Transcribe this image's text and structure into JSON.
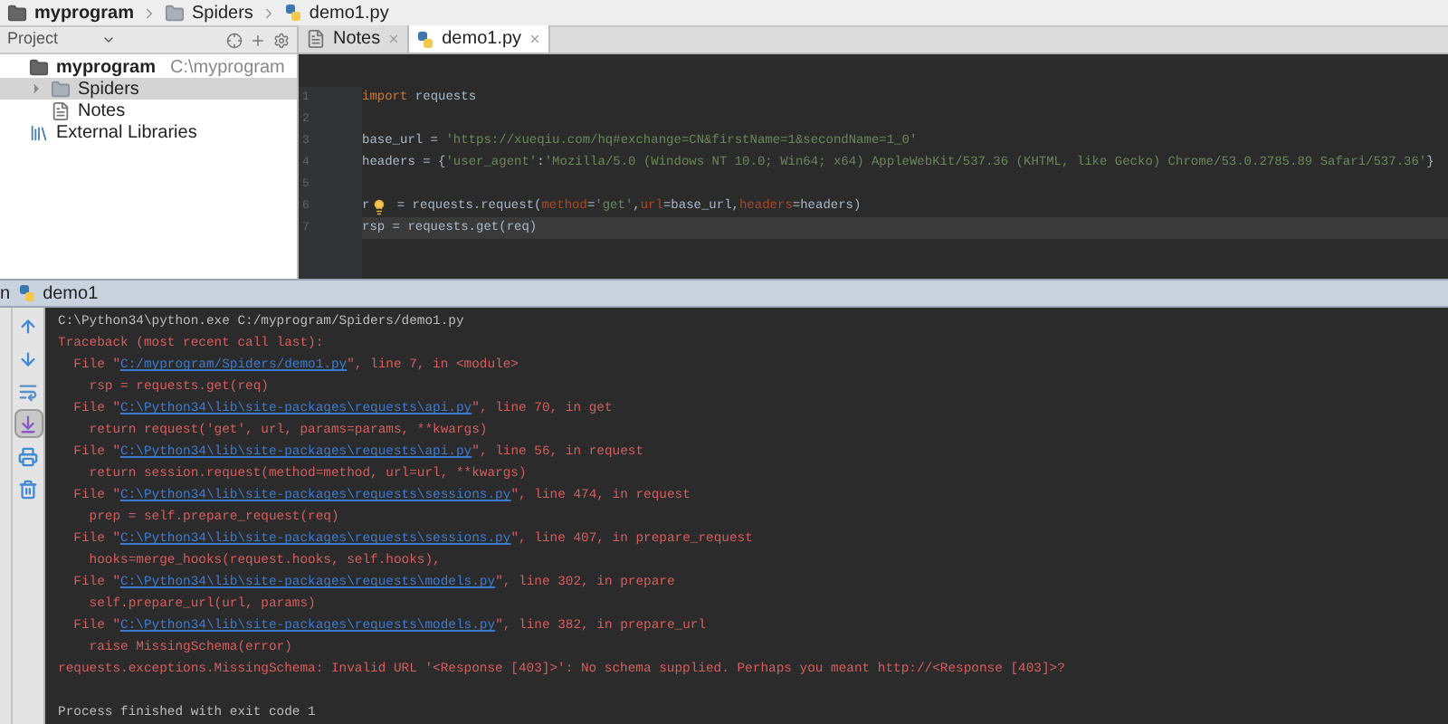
{
  "breadcrumbs": [
    {
      "label": "myprogram",
      "kind": "project"
    },
    {
      "label": "Spiders",
      "kind": "folder"
    },
    {
      "label": "demo1.py",
      "kind": "python"
    }
  ],
  "project_panel": {
    "title": "Project"
  },
  "tree": [
    {
      "label": "myprogram",
      "path": "C:\\myprogram",
      "kind": "root",
      "selected": false,
      "children": [
        {
          "label": "Spiders",
          "kind": "folder",
          "expanded": false,
          "selected": true
        },
        {
          "label": "Notes",
          "kind": "file",
          "selected": false
        }
      ]
    },
    {
      "label": "External Libraries",
      "kind": "libraries",
      "selected": false
    }
  ],
  "tabs": [
    {
      "label": "Notes",
      "kind": "file",
      "selected": false
    },
    {
      "label": "demo1.py",
      "kind": "python",
      "selected": true
    }
  ],
  "code_lines": [
    {
      "number": "1",
      "tokens": [
        {
          "text": "import",
          "kind": "keyword"
        },
        {
          "text": " requests",
          "kind": "plain"
        }
      ]
    },
    {
      "number": "2"
    },
    {
      "number": "3",
      "tokens": [
        {
          "text": "base_url = ",
          "kind": "plain"
        },
        {
          "text": "'https://xueqiu.com/hq#exchange=CN&firstName=1&secondName=1_0'",
          "kind": "string"
        }
      ]
    },
    {
      "number": "4",
      "tokens": [
        {
          "text": "headers = {",
          "kind": "plain"
        },
        {
          "text": "'user_agent'",
          "kind": "string"
        },
        {
          "text": ":",
          "kind": "plain"
        },
        {
          "text": "'Mozilla/5.0 (Windows NT 10.0; Win64; x64) AppleWebKit/537.36 (KHTML, like Gecko) Chrome/53.0.2785.89 Safari/537.36'",
          "kind": "string"
        },
        {
          "text": "}",
          "kind": "plain"
        }
      ]
    },
    {
      "number": "5"
    },
    {
      "number": "6",
      "tokens": [
        {
          "text": "r",
          "kind": "plain"
        },
        {
          "kind": "bulb"
        },
        {
          "text": " = requests.request(",
          "kind": "plain"
        },
        {
          "text": "method",
          "kind": "param"
        },
        {
          "text": "=",
          "kind": "plain"
        },
        {
          "text": "'get'",
          "kind": "string"
        },
        {
          "text": ",",
          "kind": "plain"
        },
        {
          "text": "url",
          "kind": "param"
        },
        {
          "text": "=base_url,",
          "kind": "plain"
        },
        {
          "text": "headers",
          "kind": "param"
        },
        {
          "text": "=headers)",
          "kind": "plain"
        }
      ]
    },
    {
      "number": "7",
      "current": true,
      "tokens": [
        {
          "text": "rsp = requests.get(req)",
          "kind": "plain"
        }
      ]
    }
  ],
  "run_panel": {
    "label": "n",
    "config": "demo1",
    "exit_message": "Process finished with exit code 1"
  },
  "run_toolbar": [
    {
      "kind": "up",
      "selected": false
    },
    {
      "kind": "down",
      "selected": false
    },
    {
      "kind": "wrap",
      "selected": false
    },
    {
      "kind": "scroll",
      "selected": true
    },
    {
      "kind": "print",
      "selected": false
    },
    {
      "kind": "trash",
      "selected": false
    }
  ],
  "console": [
    [
      {
        "text": "C:\\Python34\\python.exe C:/myprogram/Spiders/demo1.py",
        "kind": "plain"
      }
    ],
    [
      {
        "text": "Traceback (most recent call last):",
        "kind": "error"
      }
    ],
    [
      {
        "text": "  File \"",
        "kind": "error"
      },
      {
        "text": "C:/myprogram/Spiders/demo1.py",
        "kind": "link"
      },
      {
        "text": "\", line 7, in <module>",
        "kind": "error"
      }
    ],
    [
      {
        "text": "    rsp = requests.get(req)",
        "kind": "error"
      }
    ],
    [
      {
        "text": "  File \"",
        "kind": "error"
      },
      {
        "text": "C:\\Python34\\lib\\site-packages\\requests\\api.py",
        "kind": "link"
      },
      {
        "text": "\", line 70, in get",
        "kind": "error"
      }
    ],
    [
      {
        "text": "    return request('get', url, params=params, **kwargs)",
        "kind": "error"
      }
    ],
    [
      {
        "text": "  File \"",
        "kind": "error"
      },
      {
        "text": "C:\\Python34\\lib\\site-packages\\requests\\api.py",
        "kind": "link"
      },
      {
        "text": "\", line 56, in request",
        "kind": "error"
      }
    ],
    [
      {
        "text": "    return session.request(method=method, url=url, **kwargs)",
        "kind": "error"
      }
    ],
    [
      {
        "text": "  File \"",
        "kind": "error"
      },
      {
        "text": "C:\\Python34\\lib\\site-packages\\requests\\sessions.py",
        "kind": "link"
      },
      {
        "text": "\", line 474, in request",
        "kind": "error"
      }
    ],
    [
      {
        "text": "    prep = self.prepare_request(req)",
        "kind": "error"
      }
    ],
    [
      {
        "text": "  File \"",
        "kind": "error"
      },
      {
        "text": "C:\\Python34\\lib\\site-packages\\requests\\sessions.py",
        "kind": "link"
      },
      {
        "text": "\", line 407, in prepare_request",
        "kind": "error"
      }
    ],
    [
      {
        "text": "    hooks=merge_hooks(request.hooks, self.hooks),",
        "kind": "error"
      }
    ],
    [
      {
        "text": "  File \"",
        "kind": "error"
      },
      {
        "text": "C:\\Python34\\lib\\site-packages\\requests\\models.py",
        "kind": "link"
      },
      {
        "text": "\", line 302, in prepare",
        "kind": "error"
      }
    ],
    [
      {
        "text": "    self.prepare_url(url, params)",
        "kind": "error"
      }
    ],
    [
      {
        "text": "  File \"",
        "kind": "error"
      },
      {
        "text": "C:\\Python34\\lib\\site-packages\\requests\\models.py",
        "kind": "link"
      },
      {
        "text": "\", line 382, in prepare_url",
        "kind": "error"
      }
    ],
    [
      {
        "text": "    raise MissingSchema(error)",
        "kind": "error"
      }
    ],
    [
      {
        "text": "requests.exceptions.MissingSchema: Invalid URL '<Response [403]>': No schema supplied. Perhaps you meant http://<Response [403]>?",
        "kind": "error"
      }
    ]
  ]
}
